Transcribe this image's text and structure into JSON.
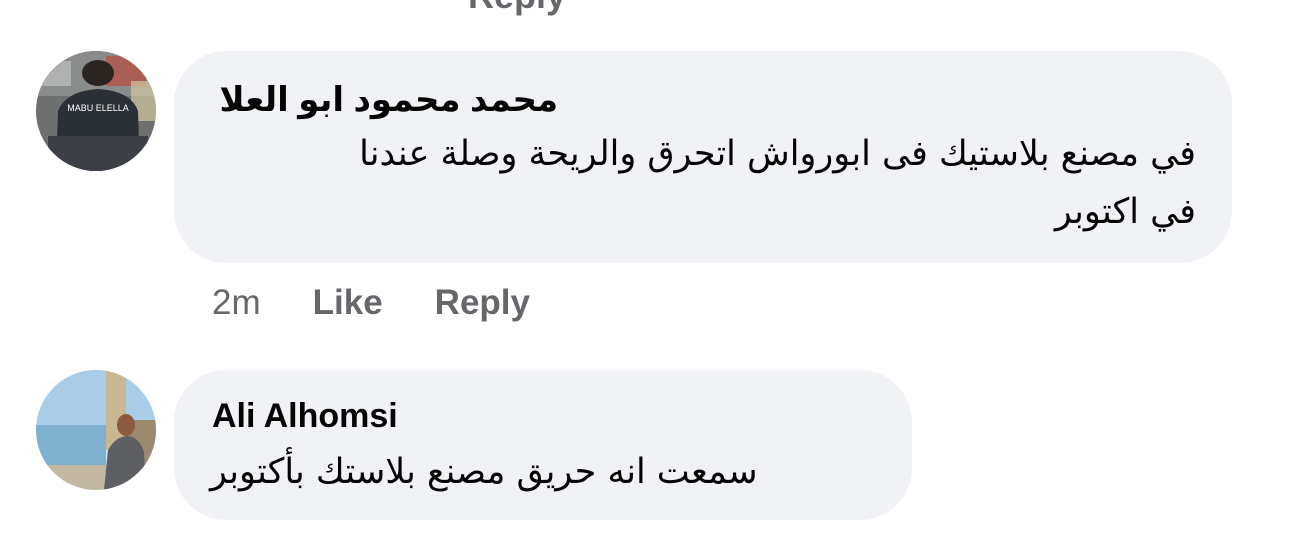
{
  "top_cut_text": "Reply",
  "comments": [
    {
      "author": "محمد محمود ابو العلا",
      "avatar_shirt_text": "MABU ELELLA",
      "text_line1": "في مصنع بلاستيك فى ابورواش اتحرق والريحة وصلة عندنا",
      "text_line2": "في اكتوبر",
      "time": "2m",
      "like_label": "Like",
      "reply_label": "Reply"
    },
    {
      "author": "Ali Alhomsi",
      "text_line1": "سمعت انه حريق مصنع بلاستك بأكتوبر"
    }
  ]
}
